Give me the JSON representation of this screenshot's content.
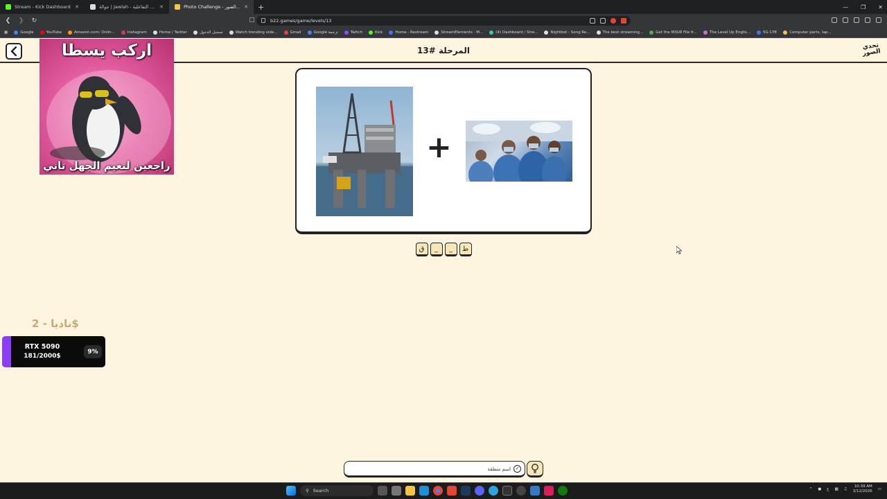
{
  "browser": {
    "tabs": [
      {
        "title": "Stream - Kick Dashboard",
        "color": "#53fc18",
        "active": false
      },
      {
        "title": "جوالة | Jawlah - منصة الألعاب التفاعلية",
        "color": "#dddddd",
        "active": false
      },
      {
        "title": "Photo Challenge - تحدي الصور",
        "color": "#f4c542",
        "active": true
      }
    ],
    "url": "b22.games/game/levels/13",
    "bookmarks": [
      {
        "label": "Google",
        "color": "#4285f4"
      },
      {
        "label": "YouTube",
        "color": "#ff0000"
      },
      {
        "label": "Amazon.com: Onlin...",
        "color": "#ff9900"
      },
      {
        "label": "Instagram",
        "color": "#e1306c"
      },
      {
        "label": "Home / Twitter",
        "color": "#dddddd"
      },
      {
        "label": "تسجيل الدخول",
        "color": "#dddddd"
      },
      {
        "label": "Watch trending vide...",
        "color": "#dddddd"
      },
      {
        "label": "Gmail",
        "color": "#ea4335"
      },
      {
        "label": "Google ترجمة",
        "color": "#4285f4"
      },
      {
        "label": "Twitch",
        "color": "#9146ff"
      },
      {
        "label": "Kick",
        "color": "#53fc18"
      },
      {
        "label": "Home - Restream",
        "color": "#3f74f5"
      },
      {
        "label": "StreamElements - M...",
        "color": "#dddddd"
      },
      {
        "label": "(4) Dashboard / Stre...",
        "color": "#2fd0a6"
      },
      {
        "label": "Nightbot - Song Re...",
        "color": "#dddddd"
      },
      {
        "label": "The best streaming...",
        "color": "#dddddd"
      },
      {
        "label": "Get the M3U8 File fr...",
        "color": "#4caf50"
      },
      {
        "label": "The Level Up Englis...",
        "color": "#c86dd7"
      },
      {
        "label": "5G CPE",
        "color": "#3f74f5"
      },
      {
        "label": "Computer parts, lap...",
        "color": "#f4c542"
      }
    ]
  },
  "header": {
    "level_title": "المرحلة #13",
    "logo_line1": "تحدي",
    "logo_line2": "الصور"
  },
  "meme": {
    "top_caption": "اركب يسطا",
    "bottom_caption": "راجعين لنعيم الجهل تاني"
  },
  "puzzle": {
    "image1_icon": "oil-rig-image",
    "image2_icon": "surgeons-image",
    "operator": "+",
    "tiles": [
      "ط",
      "_",
      "_",
      "ق"
    ]
  },
  "donation": {
    "donor_label": "ناديا - 2$",
    "goal_name": "RTX 5090",
    "goal_amount": "181/2000$",
    "goal_percent_label": "9%",
    "goal_fraction": 0.09,
    "fill_color": "#8c3cf5"
  },
  "answer": {
    "placeholder": "اسم منطقة"
  },
  "taskbar": {
    "search_label": "Search",
    "time": "10:39 AM",
    "date": "3/12/2026"
  }
}
